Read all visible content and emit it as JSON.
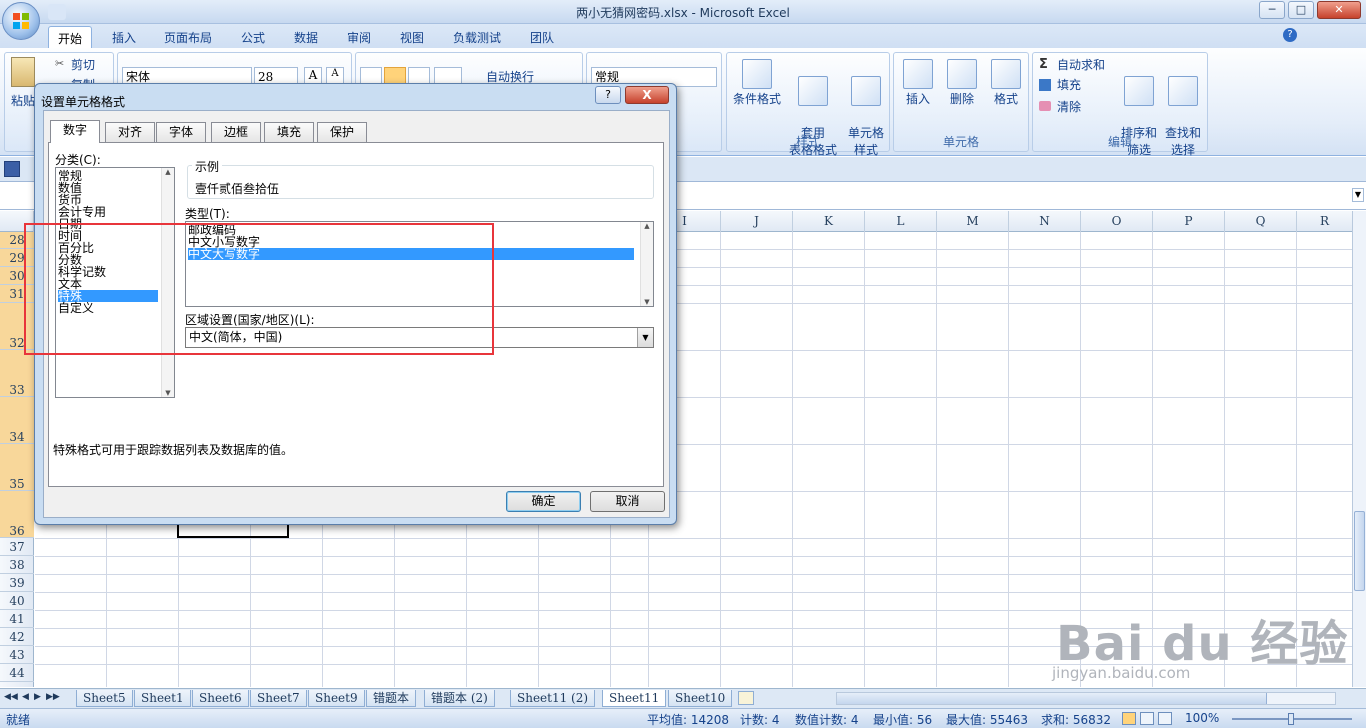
{
  "window": {
    "title": "两小无猜网密码.xlsx - Microsoft Excel",
    "min": "─",
    "max": "□",
    "close": "✕"
  },
  "ribbon_tabs": [
    "开始",
    "插入",
    "页面布局",
    "公式",
    "数据",
    "审阅",
    "视图",
    "负载测试",
    "团队"
  ],
  "ribbon": {
    "paste": "粘贴",
    "cut": "剪切",
    "copy": "复制",
    "font_name": "宋体",
    "font_size": "28",
    "wrap_text": "自动换行",
    "number_format": "常规",
    "conditional_format": "条件格式",
    "table_format": "套用\n表格格式",
    "cell_styles": "单元格\n样式",
    "styles_group": "样式",
    "insert": "插入",
    "delete": "删除",
    "format": "格式",
    "cells_group": "单元格",
    "autosum": "自动求和",
    "fill": "填充",
    "clear": "清除",
    "sort_filter": "排序和\n筛选",
    "find_select": "查找和\n选择",
    "editing_group": "编辑"
  },
  "columns": [
    "I",
    "J",
    "K",
    "L",
    "M",
    "N",
    "O",
    "P",
    "Q",
    "R"
  ],
  "rows": [
    "28",
    "29",
    "30",
    "31",
    "32",
    "33",
    "34",
    "35",
    "36",
    "37",
    "38",
    "39",
    "40",
    "41",
    "42",
    "43",
    "44"
  ],
  "sheet_nav": [
    "◀◀",
    "◀",
    "▶",
    "▶▶"
  ],
  "sheets": [
    "Sheet5",
    "Sheet1",
    "Sheet6",
    "Sheet7",
    "Sheet9",
    "错题本",
    "错题本 (2)",
    "Sheet11 (2)",
    "Sheet11",
    "Sheet10"
  ],
  "active_sheet": "Sheet11",
  "status": {
    "ready": "就绪",
    "average": "平均值: 14208",
    "count": "计数: 4",
    "numeric_count": "数值计数: 4",
    "min": "最小值: 56",
    "max": "最大值: 55463",
    "sum": "求和: 56832",
    "zoom": "100%"
  },
  "dialog": {
    "title": "设置单元格格式",
    "help": "?",
    "close": "X",
    "tabs": [
      "数字",
      "对齐",
      "字体",
      "边框",
      "填充",
      "保护"
    ],
    "category_label": "分类(C):",
    "categories": [
      "常规",
      "数值",
      "货币",
      "会计专用",
      "日期",
      "时间",
      "百分比",
      "分数",
      "科学记数",
      "文本",
      "特殊",
      "自定义"
    ],
    "selected_category": "特殊",
    "sample_label": "示例",
    "sample_value": "壹仟贰佰叁拾伍",
    "type_label": "类型(T):",
    "types": [
      "邮政编码",
      "中文小写数字",
      "中文大写数字"
    ],
    "selected_type": "中文大写数字",
    "locale_label": "区域设置(国家/地区)(L):",
    "locale_value": "中文(简体，中国)",
    "description": "特殊格式可用于跟踪数据列表及数据库的值。",
    "ok": "确定",
    "cancel": "取消"
  },
  "watermark": {
    "brand": "Bai du 经验",
    "url": "jingyan.baidu.com"
  },
  "colors": {
    "highlight": "#e8353b",
    "selection": "#3399ff",
    "accent": "#15428b"
  }
}
